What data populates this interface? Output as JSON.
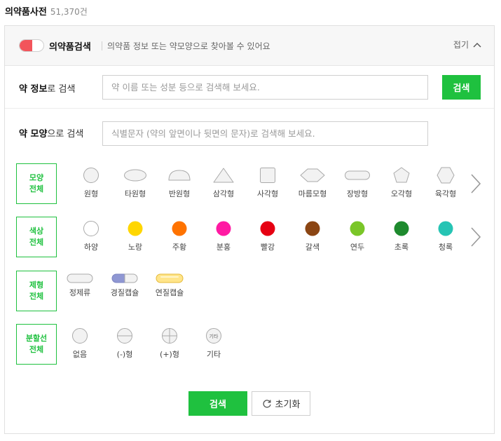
{
  "header": {
    "title": "의약품사전",
    "count": "51,370건"
  },
  "panel": {
    "title": "의약품검색",
    "description": "의약품 정보 또는 약모양으로 찾아볼 수 있어요",
    "collapse_label": "접기",
    "info_search": {
      "label_bold": "약 정보",
      "label_rest": "로 검색",
      "placeholder": "약 이름 또는 성분 등으로 검색해 보세요.",
      "button": "검색"
    },
    "shape_search": {
      "label_bold": "약 모양",
      "label_rest": "으로 검색",
      "placeholder": "식별문자 (약의 앞면이나 뒷면의 문자)로 검색해 보세요."
    },
    "filters": {
      "shape": {
        "category": "모양\n전체",
        "items": [
          {
            "label": "원형",
            "icon": "circle-icon"
          },
          {
            "label": "타원형",
            "icon": "oval-icon"
          },
          {
            "label": "반원형",
            "icon": "half-circle-icon"
          },
          {
            "label": "삼각형",
            "icon": "triangle-icon"
          },
          {
            "label": "사각형",
            "icon": "square-icon"
          },
          {
            "label": "마름모형",
            "icon": "rhombus-icon"
          },
          {
            "label": "장방형",
            "icon": "rectangle-pill-icon"
          },
          {
            "label": "오각형",
            "icon": "pentagon-icon"
          },
          {
            "label": "육각형",
            "icon": "hexagon-icon"
          }
        ]
      },
      "color": {
        "category": "색상\n전체",
        "items": [
          {
            "label": "하양",
            "color": "#ffffff"
          },
          {
            "label": "노랑",
            "color": "#ffd600"
          },
          {
            "label": "주황",
            "color": "#ff7300"
          },
          {
            "label": "분홍",
            "color": "#ff1aa3"
          },
          {
            "label": "빨강",
            "color": "#e60012"
          },
          {
            "label": "갈색",
            "color": "#8b4513"
          },
          {
            "label": "연두",
            "color": "#7ac628"
          },
          {
            "label": "초록",
            "color": "#1e8a2e"
          },
          {
            "label": "청록",
            "color": "#26c4b4"
          }
        ]
      },
      "form": {
        "category": "제형\n전체",
        "items": [
          {
            "label": "정제류",
            "icon": "tablet-icon"
          },
          {
            "label": "경질캡슐",
            "icon": "hard-capsule-icon"
          },
          {
            "label": "연질캡슐",
            "icon": "soft-capsule-icon"
          }
        ]
      },
      "split": {
        "category": "분할선\n전체",
        "items": [
          {
            "label": "없음",
            "icon": "no-line-icon"
          },
          {
            "label": "(-)형",
            "icon": "minus-line-icon"
          },
          {
            "label": "(+)형",
            "icon": "plus-line-icon"
          },
          {
            "label": "기타",
            "icon": "other-line-icon",
            "glyph": "기타"
          }
        ]
      }
    },
    "actions": {
      "search": "검색",
      "reset": "초기화"
    }
  },
  "colors": {
    "accent": "#1fc13f",
    "toggle": "#f2545b"
  }
}
